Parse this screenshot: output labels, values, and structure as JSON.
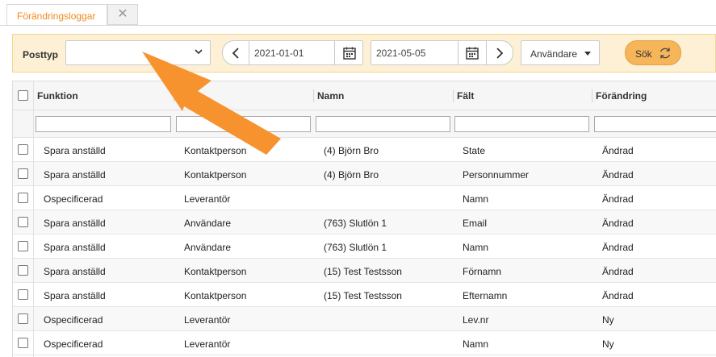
{
  "tabs": [
    {
      "label": "Förändringsloggar",
      "active": true
    }
  ],
  "tab_close_glyph": "✕",
  "toolbar": {
    "posttyp_label": "Posttyp",
    "posttyp_value": "",
    "date_from": "2021-01-01",
    "date_to": "2021-05-05",
    "user_dropdown": "Användare",
    "search_label": "Sök"
  },
  "grid": {
    "columns": [
      "Funktion",
      "",
      "Namn",
      "Fält",
      "Förändring"
    ],
    "rows": [
      {
        "funktion": "Spara anställd",
        "typ": "Kontaktperson",
        "namn": "(4) Björn Bro",
        "falt": "State",
        "forandring": "Ändrad"
      },
      {
        "funktion": "Spara anställd",
        "typ": "Kontaktperson",
        "namn": "(4) Björn Bro",
        "falt": "Personnummer",
        "forandring": "Ändrad"
      },
      {
        "funktion": "Ospecificerad",
        "typ": "Leverantör",
        "namn": "",
        "falt": "Namn",
        "forandring": "Ändrad"
      },
      {
        "funktion": "Spara anställd",
        "typ": "Användare",
        "namn": "(763) Slutlön 1",
        "falt": "Email",
        "forandring": "Ändrad"
      },
      {
        "funktion": "Spara anställd",
        "typ": "Användare",
        "namn": "(763) Slutlön 1",
        "falt": "Namn",
        "forandring": "Ändrad"
      },
      {
        "funktion": "Spara anställd",
        "typ": "Kontaktperson",
        "namn": "(15) Test Testsson",
        "falt": "Förnamn",
        "forandring": "Ändrad"
      },
      {
        "funktion": "Spara anställd",
        "typ": "Kontaktperson",
        "namn": "(15) Test Testsson",
        "falt": "Efternamn",
        "forandring": "Ändrad"
      },
      {
        "funktion": "Ospecificerad",
        "typ": "Leverantör",
        "namn": "",
        "falt": "Lev.nr",
        "forandring": "Ny"
      },
      {
        "funktion": "Ospecificerad",
        "typ": "Leverantör",
        "namn": "",
        "falt": "Namn",
        "forandring": "Ny"
      }
    ]
  },
  "colors": {
    "accent": "#f0891e",
    "toolbar_bg": "#fdf0d4",
    "search_button": "#f5b558",
    "arrow": "#f7932e"
  }
}
